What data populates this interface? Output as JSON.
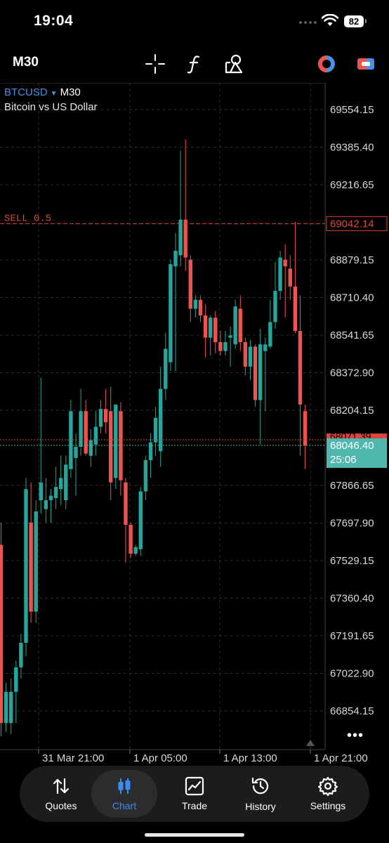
{
  "status": {
    "time": "19:04",
    "battery": "82"
  },
  "toolbar": {
    "timeframe": "M30",
    "icons": [
      "crosshair-icon",
      "function-icon",
      "objects-icon",
      "trade-signals-icon",
      "one-click-trading-icon"
    ]
  },
  "chart": {
    "symbol": "BTCUSD",
    "timeframe": "M30",
    "description": "Bitcoin vs US Dollar",
    "sell_order_label": "SELL 0.5",
    "sell_order_price": "69042.14",
    "ask_price": "68071.39",
    "bid_price": "68046.40",
    "bar_countdown": "25:06",
    "price_ticks": [
      "69554.15",
      "69385.40",
      "69216.65",
      "68879.15",
      "68710.40",
      "68541.65",
      "68372.90",
      "68204.15",
      "67866.65",
      "67697.90",
      "67529.15",
      "67360.40",
      "67191.65",
      "67022.90",
      "66854.15"
    ],
    "time_ticks": [
      "31 Mar 21:00",
      "1 Apr 05:00",
      "1 Apr 13:00",
      "1 Apr 21:00"
    ],
    "colors": {
      "bull": "#26a69a",
      "bear": "#ef5350",
      "sell_line": "#d9473f",
      "bid_line": "#4fb7ad",
      "grid": "#2a2e39"
    }
  },
  "chart_data": {
    "type": "candlestick",
    "symbol": "BTCUSD",
    "ylim": [
      66740,
      69640
    ],
    "x_labels": [
      "31 Mar 21:00",
      "1 Apr 05:00",
      "1 Apr 13:00",
      "1 Apr 21:00"
    ],
    "candles": [
      {
        "o": 67600,
        "h": 67700,
        "l": 66740,
        "c": 66800
      },
      {
        "o": 66800,
        "h": 66980,
        "l": 66760,
        "c": 66940
      },
      {
        "o": 66800,
        "h": 67000,
        "l": 66750,
        "c": 66940
      },
      {
        "o": 66940,
        "h": 67080,
        "l": 66800,
        "c": 67050
      },
      {
        "o": 67050,
        "h": 67200,
        "l": 67000,
        "c": 67160
      },
      {
        "o": 67160,
        "h": 67900,
        "l": 67100,
        "c": 67850
      },
      {
        "o": 67700,
        "h": 67880,
        "l": 67250,
        "c": 67300
      },
      {
        "o": 67300,
        "h": 67800,
        "l": 67250,
        "c": 67750
      },
      {
        "o": 67800,
        "h": 68350,
        "l": 67740,
        "c": 67880
      },
      {
        "o": 67760,
        "h": 67900,
        "l": 67700,
        "c": 67800
      },
      {
        "o": 67800,
        "h": 67850,
        "l": 67700,
        "c": 67820
      },
      {
        "o": 67810,
        "h": 67950,
        "l": 67760,
        "c": 67860
      },
      {
        "o": 67850,
        "h": 68000,
        "l": 67780,
        "c": 67900
      },
      {
        "o": 67800,
        "h": 68000,
        "l": 67760,
        "c": 67960
      },
      {
        "o": 67940,
        "h": 68250,
        "l": 67900,
        "c": 68200
      },
      {
        "o": 67990,
        "h": 68100,
        "l": 67820,
        "c": 68040
      },
      {
        "o": 68040,
        "h": 68300,
        "l": 68000,
        "c": 68200
      },
      {
        "o": 68200,
        "h": 68250,
        "l": 68000,
        "c": 68010
      },
      {
        "o": 68000,
        "h": 68120,
        "l": 67950,
        "c": 68070
      },
      {
        "o": 68050,
        "h": 68200,
        "l": 68000,
        "c": 68130
      },
      {
        "o": 68130,
        "h": 68250,
        "l": 68100,
        "c": 68210
      },
      {
        "o": 68210,
        "h": 68300,
        "l": 68100,
        "c": 68150
      },
      {
        "o": 68200,
        "h": 68310,
        "l": 67800,
        "c": 67880
      },
      {
        "o": 67900,
        "h": 68220,
        "l": 67850,
        "c": 68230
      },
      {
        "o": 68200,
        "h": 68240,
        "l": 67820,
        "c": 67890
      },
      {
        "o": 67880,
        "h": 67900,
        "l": 67520,
        "c": 67690
      },
      {
        "o": 67690,
        "h": 67700,
        "l": 67540,
        "c": 67560
      },
      {
        "o": 67560,
        "h": 67600,
        "l": 67550,
        "c": 67590
      },
      {
        "o": 67580,
        "h": 67860,
        "l": 67550,
        "c": 67840
      },
      {
        "o": 67840,
        "h": 68000,
        "l": 67800,
        "c": 67980
      },
      {
        "o": 67980,
        "h": 68100,
        "l": 67900,
        "c": 68060
      },
      {
        "o": 68060,
        "h": 68220,
        "l": 68000,
        "c": 68170
      },
      {
        "o": 68020,
        "h": 68400,
        "l": 67950,
        "c": 68300
      },
      {
        "o": 68300,
        "h": 68550,
        "l": 68250,
        "c": 68480
      },
      {
        "o": 68420,
        "h": 68880,
        "l": 68380,
        "c": 68860
      },
      {
        "o": 68850,
        "h": 69000,
        "l": 68380,
        "c": 68920
      },
      {
        "o": 68900,
        "h": 69370,
        "l": 68850,
        "c": 69060
      },
      {
        "o": 69060,
        "h": 69420,
        "l": 68830,
        "c": 68890
      },
      {
        "o": 68880,
        "h": 68900,
        "l": 68600,
        "c": 68660
      },
      {
        "o": 68660,
        "h": 68720,
        "l": 68620,
        "c": 68700
      },
      {
        "o": 68700,
        "h": 68720,
        "l": 68600,
        "c": 68630
      },
      {
        "o": 68630,
        "h": 68680,
        "l": 68440,
        "c": 68530
      },
      {
        "o": 68530,
        "h": 68630,
        "l": 68450,
        "c": 68620
      },
      {
        "o": 68620,
        "h": 68650,
        "l": 68460,
        "c": 68510
      },
      {
        "o": 68510,
        "h": 68560,
        "l": 68450,
        "c": 68470
      },
      {
        "o": 68470,
        "h": 68560,
        "l": 68450,
        "c": 68510
      },
      {
        "o": 68530,
        "h": 68580,
        "l": 68400,
        "c": 68540
      },
      {
        "o": 68500,
        "h": 68700,
        "l": 68480,
        "c": 68670
      },
      {
        "o": 68660,
        "h": 68720,
        "l": 68470,
        "c": 68510
      },
      {
        "o": 68510,
        "h": 68530,
        "l": 68360,
        "c": 68400
      },
      {
        "o": 68400,
        "h": 68520,
        "l": 68340,
        "c": 68490
      },
      {
        "o": 68490,
        "h": 68500,
        "l": 68220,
        "c": 68250
      },
      {
        "o": 68250,
        "h": 68570,
        "l": 68050,
        "c": 68500
      },
      {
        "o": 68470,
        "h": 68530,
        "l": 68200,
        "c": 68500
      },
      {
        "o": 68490,
        "h": 68700,
        "l": 68480,
        "c": 68600
      },
      {
        "o": 68600,
        "h": 68870,
        "l": 68570,
        "c": 68740
      },
      {
        "o": 68740,
        "h": 68920,
        "l": 68700,
        "c": 68890
      },
      {
        "o": 68880,
        "h": 68950,
        "l": 68620,
        "c": 68850
      },
      {
        "o": 68840,
        "h": 68900,
        "l": 68700,
        "c": 68760
      },
      {
        "o": 68760,
        "h": 69050,
        "l": 68550,
        "c": 68560
      },
      {
        "o": 68560,
        "h": 68720,
        "l": 68000,
        "c": 68230
      },
      {
        "o": 68200,
        "h": 68230,
        "l": 67940,
        "c": 68046
      }
    ]
  },
  "tabs": [
    {
      "label": "Quotes",
      "icon": "quotes-arrows-icon"
    },
    {
      "label": "Chart",
      "icon": "candlestick-chart-icon"
    },
    {
      "label": "Trade",
      "icon": "trade-chart-icon"
    },
    {
      "label": "History",
      "icon": "history-clock-icon"
    },
    {
      "label": "Settings",
      "icon": "settings-gear-icon"
    }
  ]
}
